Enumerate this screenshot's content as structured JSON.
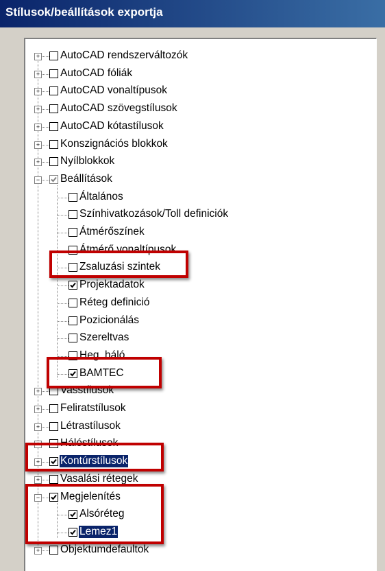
{
  "title": "Stílusok/beállítások exportja",
  "items": [
    {
      "label": "AutoCAD rendszerváltozók",
      "checked": false
    },
    {
      "label": "AutoCAD fóliák",
      "checked": false
    },
    {
      "label": "AutoCAD vonaltípusok",
      "checked": false
    },
    {
      "label": "AutoCAD szövegstílusok",
      "checked": false
    },
    {
      "label": "AutoCAD kótastílusok",
      "checked": false
    },
    {
      "label": "Konszignációs blokkok",
      "checked": false
    },
    {
      "label": "Nyílblokkok",
      "checked": false
    },
    {
      "label": "Beállítások",
      "checked": true
    },
    {
      "label": "Általános",
      "checked": false
    },
    {
      "label": "Színhivatkozások/Toll definiciók",
      "checked": false
    },
    {
      "label": "Átmérőszínek",
      "checked": false
    },
    {
      "label": "Átmérő vonaltípusok",
      "checked": false
    },
    {
      "label": "Zsaluzási szintek",
      "checked": false
    },
    {
      "label": "Projektadatok",
      "checked": true
    },
    {
      "label": "Réteg definició",
      "checked": false
    },
    {
      "label": "Pozicionálás",
      "checked": false
    },
    {
      "label": "Szereltvas",
      "checked": false
    },
    {
      "label": "Heg. háló",
      "checked": false
    },
    {
      "label": "BAMTEC",
      "checked": true
    },
    {
      "label": "Vasstílusok",
      "checked": false
    },
    {
      "label": "Feliratstílusok",
      "checked": false
    },
    {
      "label": "Létrastílusok",
      "checked": false
    },
    {
      "label": "Hálóstílusok",
      "checked": false
    },
    {
      "label": "Kontúrstílusok",
      "checked": true
    },
    {
      "label": "Vasalási rétegek",
      "checked": false
    },
    {
      "label": "Megjelenítés",
      "checked": true
    },
    {
      "label": "Alsóréteg",
      "checked": true
    },
    {
      "label": "Lemez1",
      "checked": true
    },
    {
      "label": "Objektumdefaultok",
      "checked": false
    }
  ]
}
